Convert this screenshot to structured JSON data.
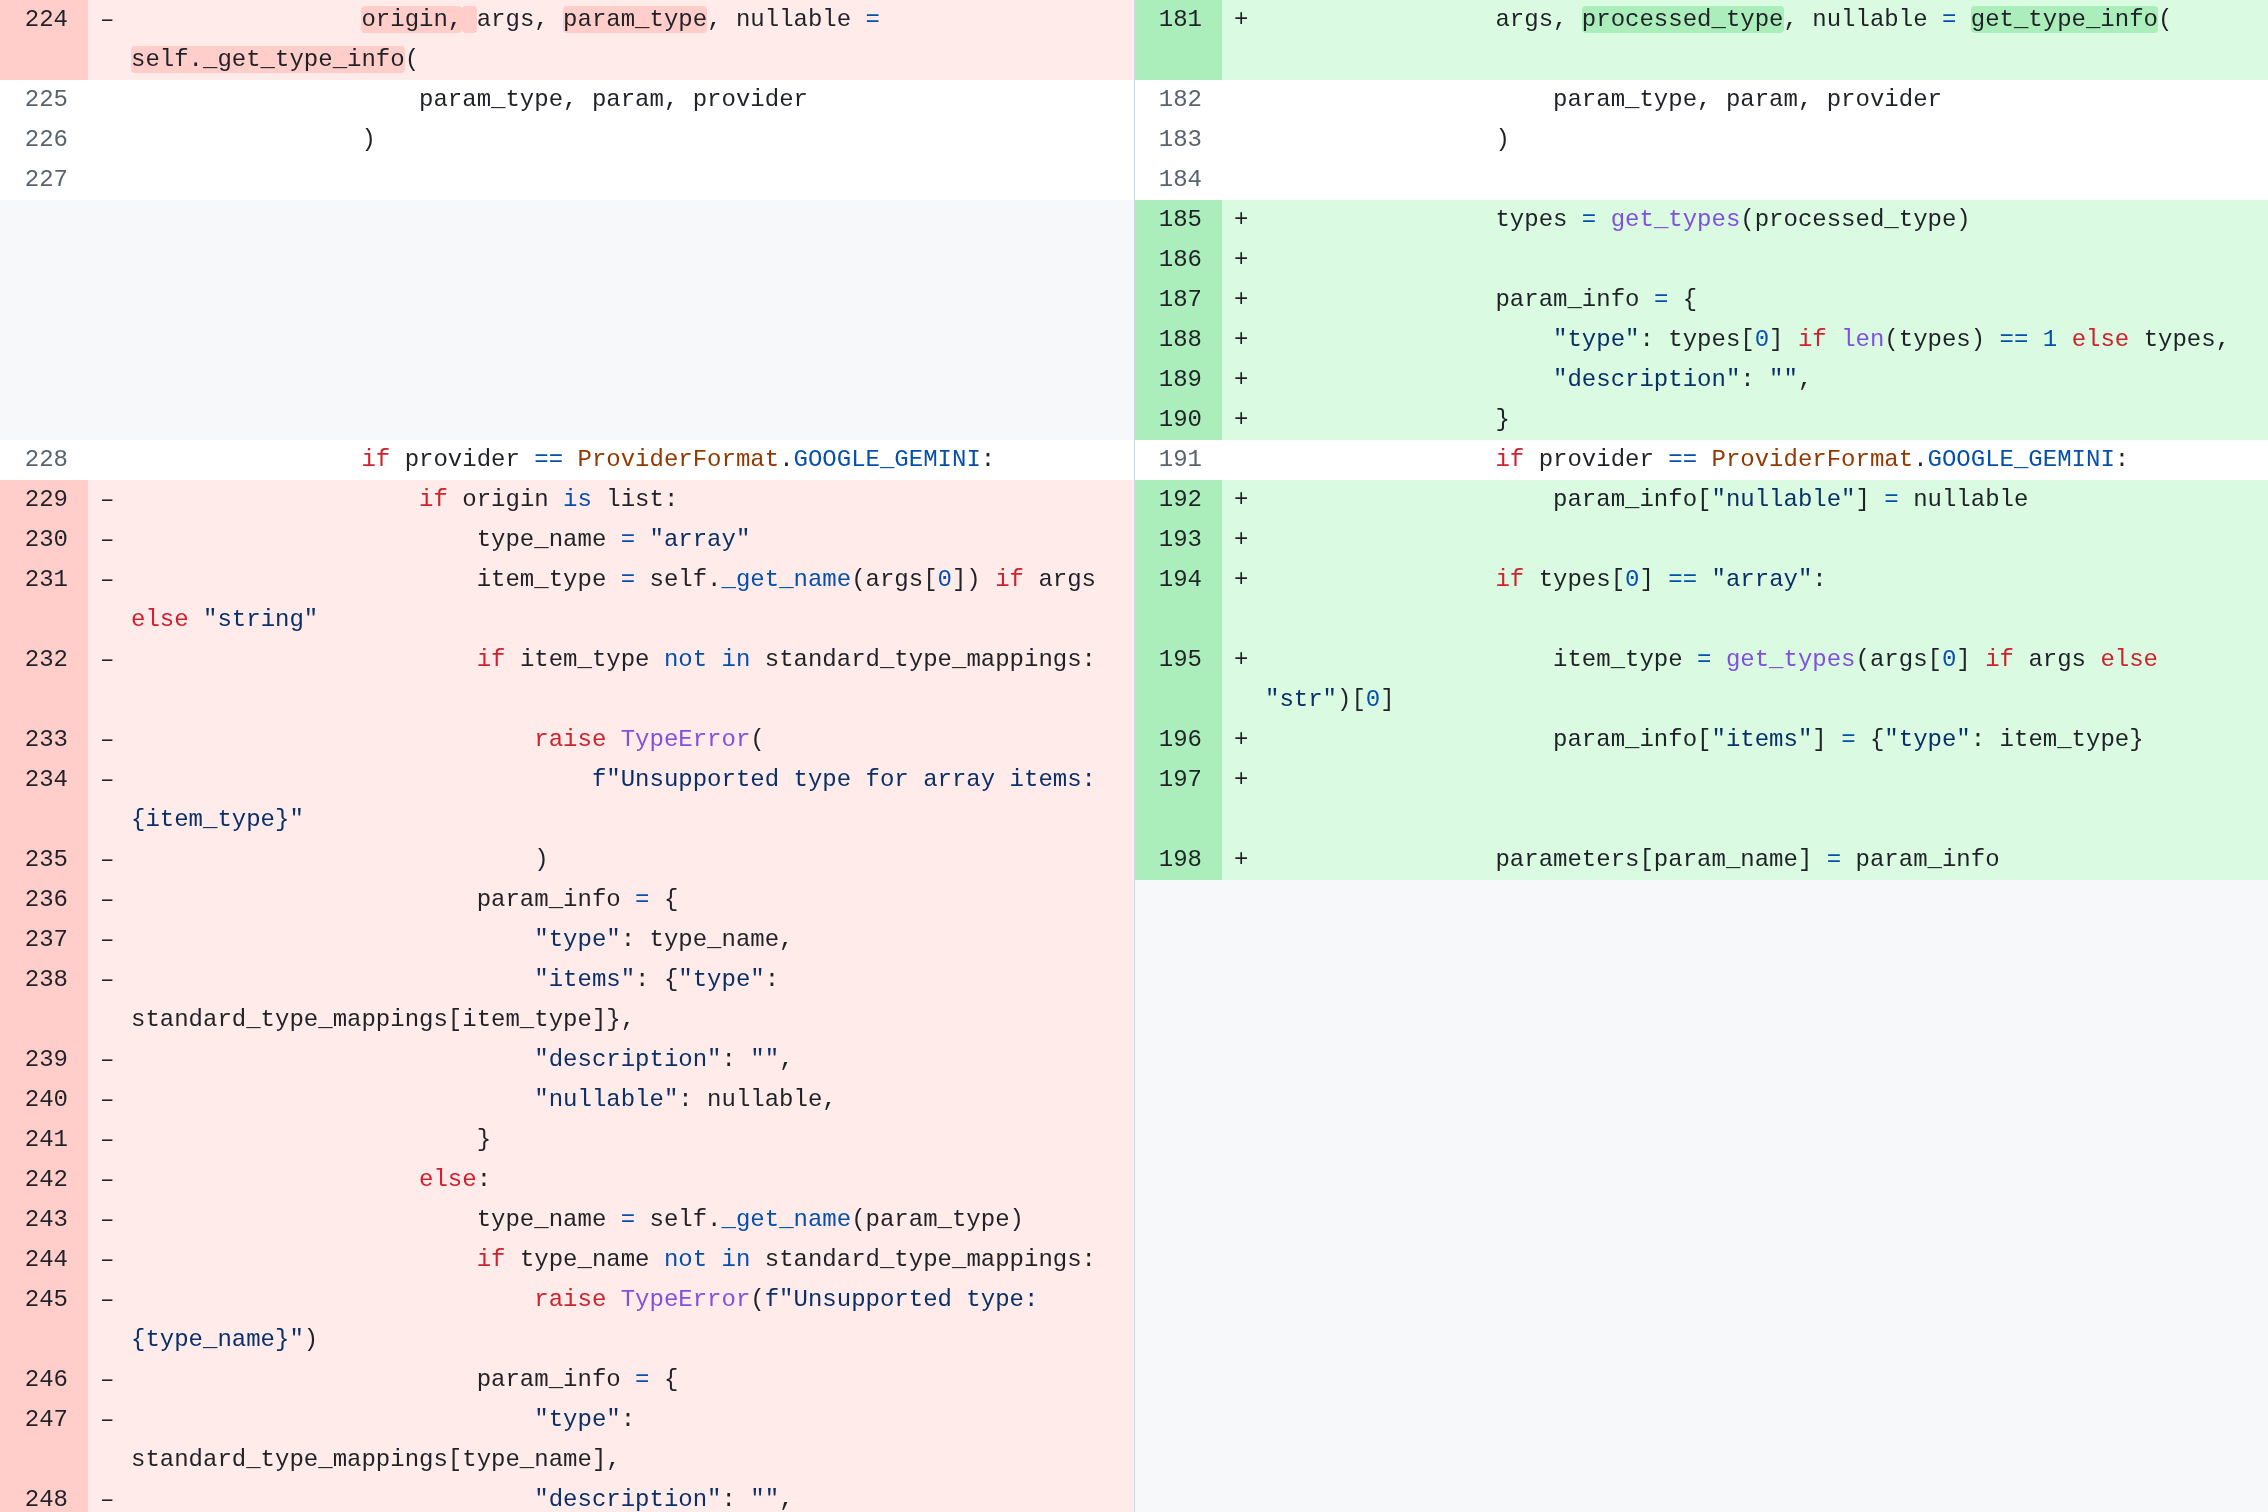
{
  "diff": {
    "rows": [
      {
        "left": {
          "number": "224",
          "kind": "del",
          "sign": "–",
          "code": [
            {
              "text": "                origin, ",
              "kind": "hl"
            },
            {
              "text": "args, "
            },
            {
              "text": "param_type",
              "kind": "hl"
            },
            {
              "text": ", nullable "
            },
            {
              "text": "= ",
              "kind": "op"
            },
            {
              "text": "self._get_type_info",
              "kind": "hl"
            },
            {
              "text": "("
            }
          ]
        },
        "right": {
          "number": "181",
          "kind": "add",
          "sign": "+",
          "code": [
            {
              "text": "                args, "
            },
            {
              "text": "processed_type",
              "kind": "hl"
            },
            {
              "text": ", nullable "
            },
            {
              "text": "= ",
              "kind": "op"
            },
            {
              "text": "get_type_info",
              "kind": "hl"
            },
            {
              "text": "("
            }
          ]
        }
      },
      {
        "left": {
          "number": "225",
          "kind": "context",
          "code": [
            {
              "text": "                    param_type, param, provider"
            }
          ]
        },
        "right": {
          "number": "182",
          "kind": "context",
          "code": [
            {
              "text": "                    param_type, param, provider"
            }
          ]
        }
      },
      {
        "left": {
          "number": "226",
          "kind": "context",
          "code": [
            {
              "text": "                )"
            }
          ]
        },
        "right": {
          "number": "183",
          "kind": "context",
          "code": [
            {
              "text": "                )"
            }
          ]
        }
      },
      {
        "left": {
          "number": "227",
          "kind": "context"
        },
        "right": {
          "number": "184",
          "kind": "context"
        }
      },
      {
        "right": {
          "number": "185",
          "kind": "add",
          "sign": "+",
          "code": [
            {
              "text": "                types "
            },
            {
              "text": "= ",
              "kind": "op"
            },
            {
              "text": "get_types",
              "kind": "fn"
            },
            {
              "text": "(processed_type)"
            }
          ]
        }
      },
      {
        "right": {
          "number": "186",
          "kind": "add",
          "sign": "+"
        }
      },
      {
        "right": {
          "number": "187",
          "kind": "add",
          "sign": "+",
          "code": [
            {
              "text": "                param_info "
            },
            {
              "text": "=",
              "kind": "op"
            },
            {
              "text": " {"
            }
          ]
        }
      },
      {
        "right": {
          "number": "188",
          "kind": "add",
          "sign": "+",
          "code": [
            {
              "text": "                    \"type\"",
              "kind": "str"
            },
            {
              "text": ": types["
            },
            {
              "text": "0",
              "kind": "op"
            },
            {
              "text": "] "
            },
            {
              "text": "if ",
              "kind": "kw"
            },
            {
              "text": "len",
              "kind": "fn"
            },
            {
              "text": "(types) "
            },
            {
              "text": "== 1 ",
              "kind": "op"
            },
            {
              "text": "else",
              "kind": "kw"
            },
            {
              "text": " types,"
            }
          ]
        }
      },
      {
        "right": {
          "number": "189",
          "kind": "add",
          "sign": "+",
          "code": [
            {
              "text": "                    \"description\"",
              "kind": "str"
            },
            {
              "text": ": "
            },
            {
              "text": "\"\"",
              "kind": "str"
            },
            {
              "text": ","
            }
          ]
        }
      },
      {
        "right": {
          "number": "190",
          "kind": "add",
          "sign": "+",
          "code": [
            {
              "text": "                }"
            }
          ]
        }
      },
      {
        "left": {
          "number": "228",
          "kind": "context",
          "code": [
            {
              "text": "                if",
              "kind": "kw"
            },
            {
              "text": " provider "
            },
            {
              "text": "== ",
              "kind": "op"
            },
            {
              "text": "ProviderFormat",
              "kind": "cls"
            },
            {
              "text": "."
            },
            {
              "text": "GOOGLE_GEMINI",
              "kind": "op"
            },
            {
              "text": ":"
            }
          ]
        },
        "right": {
          "number": "191",
          "kind": "context",
          "code": [
            {
              "text": "                if",
              "kind": "kw"
            },
            {
              "text": " provider "
            },
            {
              "text": "== ",
              "kind": "op"
            },
            {
              "text": "ProviderFormat",
              "kind": "cls"
            },
            {
              "text": "."
            },
            {
              "text": "GOOGLE_GEMINI",
              "kind": "op"
            },
            {
              "text": ":"
            }
          ]
        }
      },
      {
        "left": {
          "number": "229",
          "kind": "del",
          "sign": "–",
          "code": [
            {
              "text": "                    if",
              "kind": "kw"
            },
            {
              "text": " origin "
            },
            {
              "text": "is",
              "kind": "op"
            },
            {
              "text": " list:"
            }
          ]
        },
        "right": {
          "number": "192",
          "kind": "add",
          "sign": "+",
          "code": [
            {
              "text": "                    param_info["
            },
            {
              "text": "\"nullable\"",
              "kind": "str"
            },
            {
              "text": "] "
            },
            {
              "text": "=",
              "kind": "op"
            },
            {
              "text": " nullable"
            }
          ]
        }
      },
      {
        "left": {
          "number": "230",
          "kind": "del",
          "sign": "–",
          "code": [
            {
              "text": "                        type_name "
            },
            {
              "text": "= ",
              "kind": "op"
            },
            {
              "text": "\"array\"",
              "kind": "str"
            }
          ]
        },
        "right": {
          "number": "193",
          "kind": "add",
          "sign": "+"
        }
      },
      {
        "left": {
          "number": "231",
          "kind": "del",
          "sign": "–",
          "code": [
            {
              "text": "                        item_type "
            },
            {
              "text": "=",
              "kind": "op"
            },
            {
              "text": " self."
            },
            {
              "text": "_get_name",
              "kind": "op"
            },
            {
              "text": "(args["
            },
            {
              "text": "0",
              "kind": "op"
            },
            {
              "text": "]) "
            },
            {
              "text": "if",
              "kind": "kw"
            },
            {
              "text": " args "
            },
            {
              "text": "else ",
              "kind": "kw"
            },
            {
              "text": "\"string\"",
              "kind": "str"
            }
          ]
        },
        "right": {
          "number": "194",
          "kind": "add",
          "sign": "+",
          "code": [
            {
              "text": "                if",
              "kind": "kw"
            },
            {
              "text": " types["
            },
            {
              "text": "0",
              "kind": "op"
            },
            {
              "text": "] "
            },
            {
              "text": "== ",
              "kind": "op"
            },
            {
              "text": "\"array\"",
              "kind": "str"
            },
            {
              "text": ":"
            }
          ]
        }
      },
      {
        "left": {
          "number": "232",
          "kind": "del",
          "sign": "–",
          "code": [
            {
              "text": "                        if",
              "kind": "kw"
            },
            {
              "text": " item_type "
            },
            {
              "text": "not in",
              "kind": "op"
            },
            {
              "text": " standard_type_mappings:"
            }
          ]
        },
        "right": {
          "number": "195",
          "kind": "add",
          "sign": "+",
          "code": [
            {
              "text": "                    item_type "
            },
            {
              "text": "= ",
              "kind": "op"
            },
            {
              "text": "get_types",
              "kind": "fn"
            },
            {
              "text": "(args["
            },
            {
              "text": "0",
              "kind": "op"
            },
            {
              "text": "] "
            },
            {
              "text": "if",
              "kind": "kw"
            },
            {
              "text": " args "
            },
            {
              "text": "else ",
              "kind": "kw"
            },
            {
              "text": "\"str\"",
              "kind": "str"
            },
            {
              "text": ")["
            },
            {
              "text": "0",
              "kind": "op"
            },
            {
              "text": "]"
            }
          ]
        }
      },
      {
        "left": {
          "number": "233",
          "kind": "del",
          "sign": "–",
          "code": [
            {
              "text": "                            raise ",
              "kind": "kw"
            },
            {
              "text": "TypeError",
              "kind": "fn"
            },
            {
              "text": "("
            }
          ]
        },
        "right": {
          "number": "196",
          "kind": "add",
          "sign": "+",
          "code": [
            {
              "text": "                    param_info["
            },
            {
              "text": "\"items\"",
              "kind": "str"
            },
            {
              "text": "] "
            },
            {
              "text": "=",
              "kind": "op"
            },
            {
              "text": " {"
            },
            {
              "text": "\"type\"",
              "kind": "str"
            },
            {
              "text": ": item_type}"
            }
          ]
        }
      },
      {
        "left": {
          "number": "234",
          "kind": "del",
          "sign": "–",
          "code": [
            {
              "text": "                                f\"Unsupported type for array items: {item_type}\"",
              "kind": "str"
            }
          ]
        },
        "right": {
          "number": "197",
          "kind": "add",
          "sign": "+"
        }
      },
      {
        "left": {
          "number": "235",
          "kind": "del",
          "sign": "–",
          "code": [
            {
              "text": "                            )"
            }
          ]
        },
        "right": {
          "number": "198",
          "kind": "add",
          "sign": "+",
          "code": [
            {
              "text": "                parameters[param_name] "
            },
            {
              "text": "=",
              "kind": "op"
            },
            {
              "text": " param_info"
            }
          ]
        }
      },
      {
        "left": {
          "number": "236",
          "kind": "del",
          "sign": "–",
          "code": [
            {
              "text": "                        param_info "
            },
            {
              "text": "=",
              "kind": "op"
            },
            {
              "text": " {"
            }
          ]
        }
      },
      {
        "left": {
          "number": "237",
          "kind": "del",
          "sign": "–",
          "code": [
            {
              "text": "                            \"type\"",
              "kind": "str"
            },
            {
              "text": ": type_name,"
            }
          ]
        }
      },
      {
        "left": {
          "number": "238",
          "kind": "del",
          "sign": "–",
          "code": [
            {
              "text": "                            \"items\"",
              "kind": "str"
            },
            {
              "text": ": {"
            },
            {
              "text": "\"type\"",
              "kind": "str"
            },
            {
              "text": ": standard_type_mappings[item_type]},"
            }
          ]
        }
      },
      {
        "left": {
          "number": "239",
          "kind": "del",
          "sign": "–",
          "code": [
            {
              "text": "                            \"description\"",
              "kind": "str"
            },
            {
              "text": ": "
            },
            {
              "text": "\"\"",
              "kind": "str"
            },
            {
              "text": ","
            }
          ]
        }
      },
      {
        "left": {
          "number": "240",
          "kind": "del",
          "sign": "–",
          "code": [
            {
              "text": "                            \"nullable\"",
              "kind": "str"
            },
            {
              "text": ": nullable,"
            }
          ]
        }
      },
      {
        "left": {
          "number": "241",
          "kind": "del",
          "sign": "–",
          "code": [
            {
              "text": "                        }"
            }
          ]
        }
      },
      {
        "left": {
          "number": "242",
          "kind": "del",
          "sign": "–",
          "code": [
            {
              "text": "                    else",
              "kind": "kw"
            },
            {
              "text": ":"
            }
          ]
        }
      },
      {
        "left": {
          "number": "243",
          "kind": "del",
          "sign": "–",
          "code": [
            {
              "text": "                        type_name "
            },
            {
              "text": "=",
              "kind": "op"
            },
            {
              "text": " self."
            },
            {
              "text": "_get_name",
              "kind": "op"
            },
            {
              "text": "(param_type)"
            }
          ]
        }
      },
      {
        "left": {
          "number": "244",
          "kind": "del",
          "sign": "–",
          "code": [
            {
              "text": "                        if",
              "kind": "kw"
            },
            {
              "text": " type_name "
            },
            {
              "text": "not in",
              "kind": "op"
            },
            {
              "text": " standard_type_mappings:"
            }
          ]
        }
      },
      {
        "left": {
          "number": "245",
          "kind": "del",
          "sign": "–",
          "code": [
            {
              "text": "                            raise ",
              "kind": "kw"
            },
            {
              "text": "TypeError",
              "kind": "fn"
            },
            {
              "text": "("
            },
            {
              "text": "f\"Unsupported type: {type_name}\"",
              "kind": "str"
            },
            {
              "text": ")"
            }
          ]
        }
      },
      {
        "left": {
          "number": "246",
          "kind": "del",
          "sign": "–",
          "code": [
            {
              "text": "                        param_info "
            },
            {
              "text": "=",
              "kind": "op"
            },
            {
              "text": " {"
            }
          ]
        }
      },
      {
        "left": {
          "number": "247",
          "kind": "del",
          "sign": "–",
          "code": [
            {
              "text": "                            \"type\"",
              "kind": "str"
            },
            {
              "text": ": standard_type_mappings[type_name],"
            }
          ]
        }
      },
      {
        "left": {
          "number": "248",
          "kind": "del",
          "sign": "–",
          "code": [
            {
              "text": "                            \"description\"",
              "kind": "str"
            },
            {
              "text": ": "
            },
            {
              "text": "\"\"",
              "kind": "str"
            },
            {
              "text": ","
            }
          ]
        }
      }
    ]
  }
}
